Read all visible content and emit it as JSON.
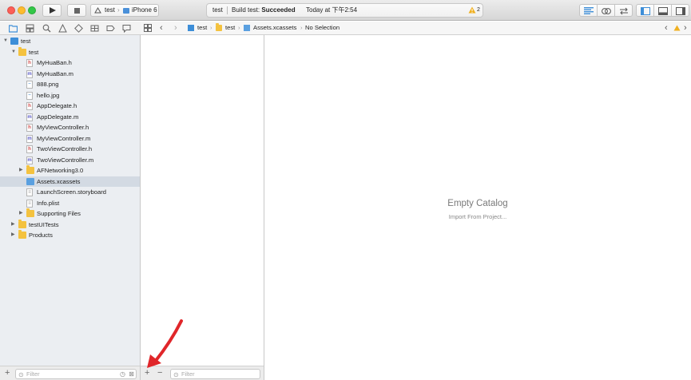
{
  "toolbar": {
    "scheme": {
      "project": "test",
      "device": "iPhone 6"
    },
    "activity": {
      "project": "test",
      "status_prefix": "Build test: ",
      "status_value": "Succeeded",
      "time": "Today at 下午2:54",
      "warning_count": "2"
    }
  },
  "navigator": {
    "tree": [
      {
        "label": "test",
        "icon": "project-icon",
        "depth": 0,
        "disclosure": "open"
      },
      {
        "label": "test",
        "icon": "folder-icon",
        "depth": 1,
        "disclosure": "open"
      },
      {
        "label": "MyHuaBan.h",
        "icon": "header-file-icon",
        "depth": 2
      },
      {
        "label": "MyHuaBan.m",
        "icon": "source-file-icon",
        "depth": 2
      },
      {
        "label": "888.png",
        "icon": "image-file-icon",
        "depth": 2
      },
      {
        "label": "hello.jpg",
        "icon": "image-file-icon",
        "depth": 2
      },
      {
        "label": "AppDelegate.h",
        "icon": "header-file-icon",
        "depth": 2
      },
      {
        "label": "AppDelegate.m",
        "icon": "source-file-icon",
        "depth": 2
      },
      {
        "label": "MyViewController.h",
        "icon": "header-file-icon",
        "depth": 2
      },
      {
        "label": "MyViewController.m",
        "icon": "source-file-icon",
        "depth": 2
      },
      {
        "label": "TwoViewController.h",
        "icon": "header-file-icon",
        "depth": 2
      },
      {
        "label": "TwoViewController.m",
        "icon": "source-file-icon",
        "depth": 2
      },
      {
        "label": "AFNetworking3.0",
        "icon": "folder-icon",
        "depth": 2,
        "disclosure": "closed"
      },
      {
        "label": "Assets.xcassets",
        "icon": "asset-catalog-icon",
        "depth": 2,
        "selected": true
      },
      {
        "label": "LaunchScreen.storyboard",
        "icon": "storyboard-file-icon",
        "depth": 2
      },
      {
        "label": "Info.plist",
        "icon": "plist-file-icon",
        "depth": 2
      },
      {
        "label": "Supporting Files",
        "icon": "folder-icon",
        "depth": 2,
        "disclosure": "closed"
      },
      {
        "label": "testUITests",
        "icon": "folder-icon",
        "depth": 1,
        "disclosure": "closed"
      },
      {
        "label": "Products",
        "icon": "folder-icon",
        "depth": 1,
        "disclosure": "closed"
      }
    ],
    "filter_placeholder": "Filter"
  },
  "jumpbar": {
    "crumbs": [
      "test",
      "test",
      "Assets.xcassets",
      "No Selection"
    ]
  },
  "setlist": {
    "filter_placeholder": "Filter"
  },
  "catalog": {
    "empty_title": "Empty Catalog",
    "import_link": "Import From Project..."
  },
  "colors": {
    "selection": "#d3dae3",
    "folder": "#f4c23f",
    "arrow": "#e0262a",
    "warning": "#f0b020"
  }
}
